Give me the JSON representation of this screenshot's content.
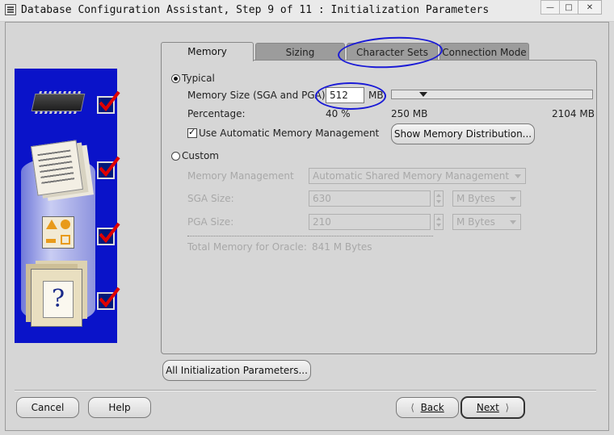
{
  "window": {
    "title": "Database Configuration Assistant, Step 9 of 11 : Initialization Parameters"
  },
  "tabs": [
    {
      "label": "Memory",
      "active": true
    },
    {
      "label": "Sizing",
      "active": false
    },
    {
      "label": "Character Sets",
      "active": false
    },
    {
      "label": "Connection Mode",
      "active": false
    }
  ],
  "typical": {
    "label": "Typical",
    "selected": true,
    "memory_size_label": "Memory Size (SGA and PGA):",
    "memory_size_value": "512",
    "memory_unit": "MB",
    "percentage_label": "Percentage:",
    "percentage_value": "40 %",
    "slider_min": "250 MB",
    "slider_max": "2104 MB",
    "slider_fraction": 0.14,
    "auto_mem_label": "Use Automatic Memory Management",
    "auto_mem_checked": true,
    "show_dist_button": "Show Memory Distribution..."
  },
  "custom": {
    "label": "Custom",
    "selected": false,
    "mem_mgmt_label": "Memory Management",
    "mem_mgmt_value": "Automatic Shared Memory Management",
    "sga_label": "SGA Size:",
    "sga_value": "630",
    "sga_unit": "M Bytes",
    "pga_label": "PGA Size:",
    "pga_value": "210",
    "pga_unit": "M Bytes",
    "total_label": "Total Memory for Oracle:",
    "total_value": "841 M Bytes"
  },
  "buttons": {
    "all_params": "All Initialization Parameters...",
    "cancel": "Cancel",
    "help": "Help",
    "back": "Back",
    "next": "Next"
  },
  "colors": {
    "annotation_circle": "#1a1ad6",
    "wizard_panel": "#0a13c9",
    "check_mark": "#e00000"
  },
  "icons": [
    "window-app-icon",
    "chip-icon",
    "document-stack-icon",
    "shapes-icon",
    "help-folder-icon",
    "step-check-icon"
  ]
}
